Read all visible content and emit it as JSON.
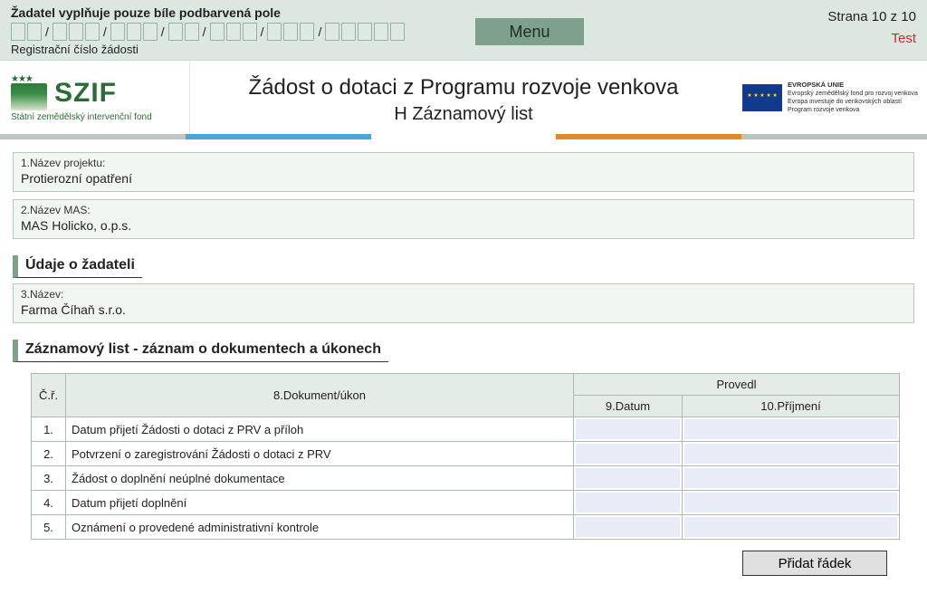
{
  "top_note": "Žadatel vyplňuje pouze bíle podbarvená pole",
  "reg_caption": "Registrační číslo žádosti",
  "reg_groups": [
    2,
    3,
    3,
    2,
    3,
    3,
    5
  ],
  "menu_label": "Menu",
  "page_indicator": "Strana 10 z 10",
  "test_label": "Test",
  "szif": {
    "name": "SZIF",
    "sub": "Státní zemědělský intervenční fond"
  },
  "title": {
    "main": "Žádost o dotaci z Programu rozvoje venkova",
    "sub": "H Záznamový list"
  },
  "eu_text": {
    "l1": "EVROPSKÁ UNIE",
    "l2": "Evropský zemědělský fond pro rozvoj venkova",
    "l3": "Evropa investuje do venkovských oblastí",
    "l4": "Program rozvoje venkova"
  },
  "stripe_colors": [
    "#c0c6c2",
    "#4aa6d4",
    "#ffffff",
    "#dc8a2a",
    "#b9c4bd"
  ],
  "fields": {
    "f1_label": "1.Název projektu:",
    "f1_value": "Protierozní opatření",
    "f2_label": "2.Název MAS:",
    "f2_value": "MAS Holicko, o.p.s.",
    "sec_applicant": "Údaje o žadateli",
    "f3_label": "3.Název:",
    "f3_value": "Farma Číhaň s.r.o.",
    "sec_records": "Záznamový list - záznam o dokumentech a úkonech"
  },
  "table": {
    "h_cr": "Č.ř.",
    "h_doc": "8.Dokument/úkon",
    "h_provedl": "Provedl",
    "h_date": "9.Datum",
    "h_surname": "10.Příjmení",
    "rows": [
      {
        "n": "1.",
        "doc": "Datum přijetí Žádosti o dotaci z PRV a příloh",
        "date": "",
        "surname": ""
      },
      {
        "n": "2.",
        "doc": "Potvrzení o zaregistrování Žádosti o dotaci z PRV",
        "date": "",
        "surname": ""
      },
      {
        "n": "3.",
        "doc": "Žádost o doplnění neúplné dokumentace",
        "date": "",
        "surname": ""
      },
      {
        "n": "4.",
        "doc": "Datum přijetí doplnění",
        "date": "",
        "surname": ""
      },
      {
        "n": "5.",
        "doc": "Oznámení o provedené administrativní kontrole",
        "date": "",
        "surname": ""
      }
    ]
  },
  "add_row_label": "Přidat řádek"
}
